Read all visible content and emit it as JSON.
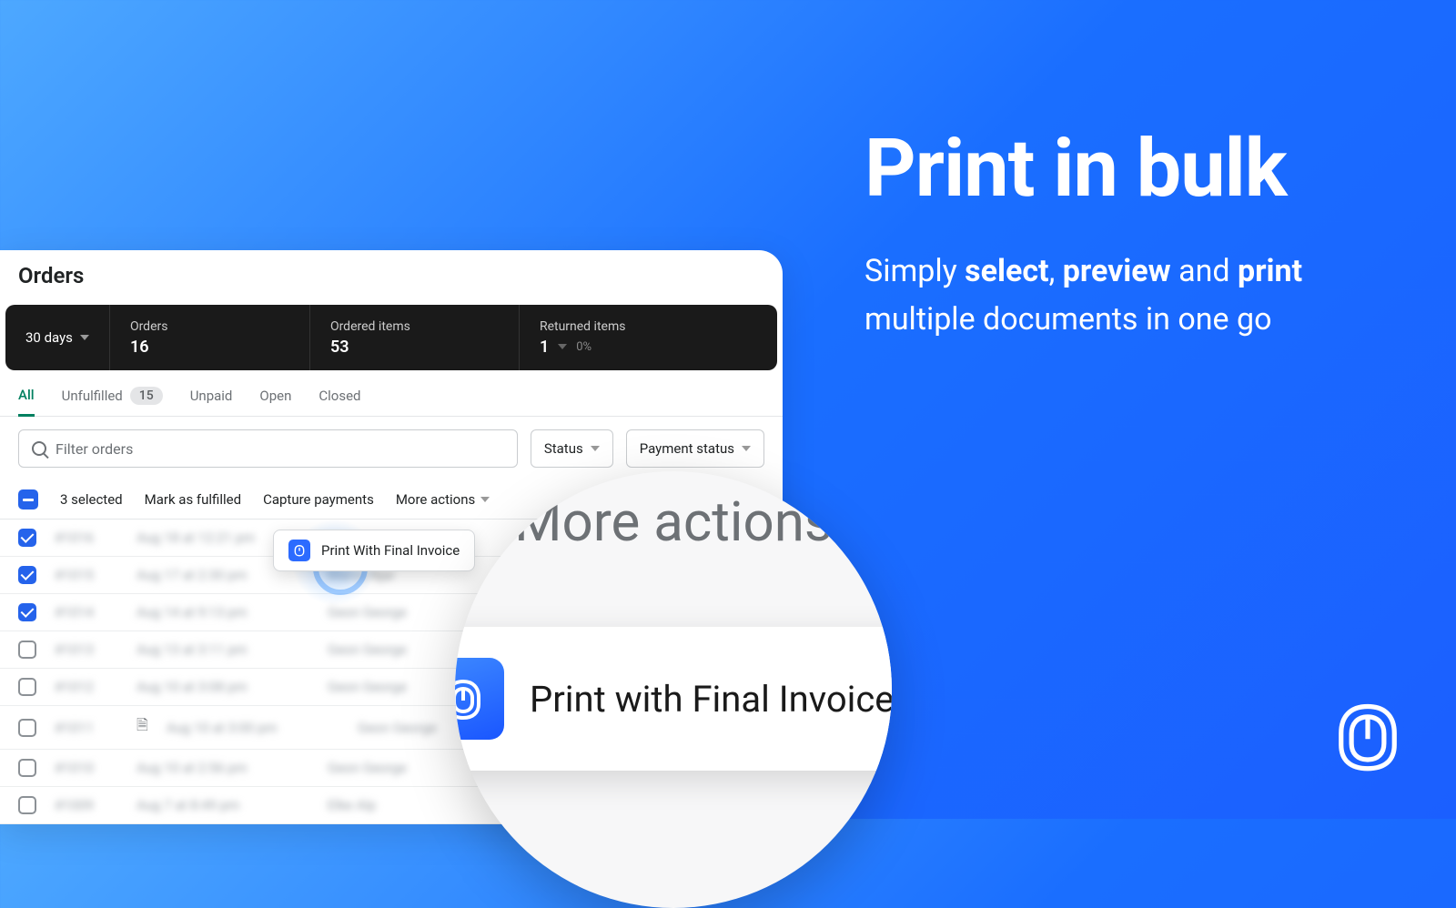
{
  "hero": {
    "title": "Print in bulk",
    "sub_prefix": "Simply ",
    "b1": "select",
    "mid1": ", ",
    "b2": "preview",
    "mid2": " and ",
    "b3": "print",
    "suffix": " multiple documents in one go"
  },
  "panel": {
    "title": "Orders"
  },
  "summary": {
    "period": "30 days",
    "orders_label": "Orders",
    "orders_value": "16",
    "items_label": "Ordered items",
    "items_value": "53",
    "returned_label": "Returned items",
    "returned_value": "1",
    "returned_pct": "0%"
  },
  "tabs": {
    "all": "All",
    "unfulfilled": "Unfulfilled",
    "unfulfilled_count": "15",
    "unpaid": "Unpaid",
    "open": "Open",
    "closed": "Closed"
  },
  "search": {
    "placeholder": "Filter orders"
  },
  "filters": {
    "status": "Status",
    "payment": "Payment status"
  },
  "actionbar": {
    "selected": "3 selected",
    "fulfilled": "Mark as fulfilled",
    "capture": "Capture payments",
    "more": "More actions"
  },
  "dropdown": {
    "label": "Print With Final Invoice"
  },
  "magnifier": {
    "heading": "More actions",
    "action_label": "Print with Final Invoice"
  },
  "rows": [
    {
      "checked": true,
      "id": "#1016",
      "date": "Aug 18 at 12:21 pm",
      "cust": "—"
    },
    {
      "checked": true,
      "id": "#1015",
      "date": "Aug 17 at 2:30 pm",
      "cust": "Marco Njar"
    },
    {
      "checked": true,
      "id": "#1014",
      "date": "Aug 14 at 9:13 pm",
      "cust": "Geon George"
    },
    {
      "checked": false,
      "id": "#1013",
      "date": "Aug 13 at 3:11 pm",
      "cust": "Geon George"
    },
    {
      "checked": false,
      "id": "#1012",
      "date": "Aug 10 at 3:08 pm",
      "cust": "Geon George"
    },
    {
      "checked": false,
      "id": "#1011",
      "date": "Aug 10 at 3:00 pm",
      "cust": "Geon George",
      "doc": true
    },
    {
      "checked": false,
      "id": "#1010",
      "date": "Aug 10 at 2:56 pm",
      "cust": "Geon George"
    },
    {
      "checked": false,
      "id": "#1009",
      "date": "Aug 7 at 8:49 pm",
      "cust": "Elke Alp"
    }
  ]
}
